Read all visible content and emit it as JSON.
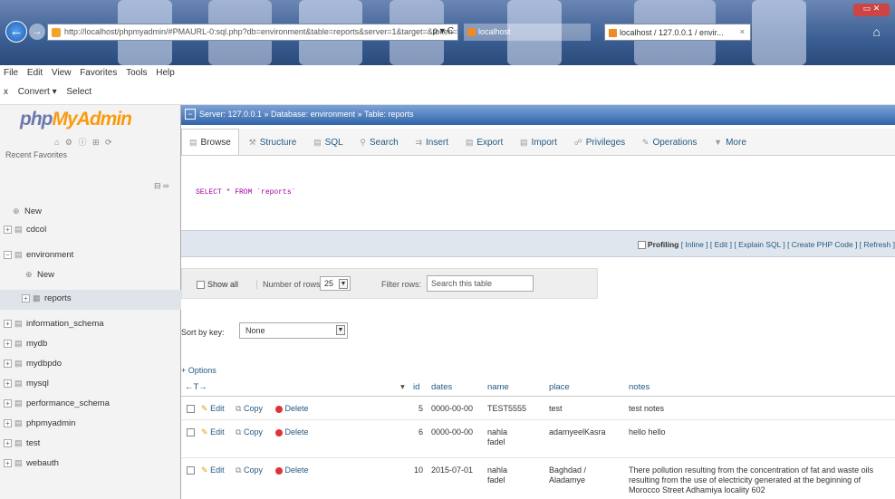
{
  "browser": {
    "address": "http://localhost/phpmyadmin/#PMAURL-0:sql.php?db=environment&table=reports&server=1&target=&token=",
    "address_controls": "ρ ▾ C",
    "tab_inactive": "localhost",
    "tab_active": "localhost / 127.0.0.1 / envir...",
    "tab_close": "×"
  },
  "menubar": [
    "File",
    "Edit",
    "View",
    "Favorites",
    "Tools",
    "Help"
  ],
  "commandbar": [
    "x",
    "Convert ▾",
    "Select"
  ],
  "sidebar": {
    "logo_php": "php",
    "logo_myadmin": "MyAdmin",
    "logo_icons": "⌂ ⚙ ⓘ ⊞ ⟳",
    "tabs": "Recent  Favorites",
    "controls": "⊟ ∞",
    "items": [
      {
        "label": "New",
        "top": 0
      },
      {
        "label": "cdcol"
      },
      {
        "label": "environment"
      },
      {
        "label": "New"
      },
      {
        "label": "reports"
      },
      {
        "label": "information_schema"
      },
      {
        "label": "mydb"
      },
      {
        "label": "mydbpdo"
      },
      {
        "label": "mysql"
      },
      {
        "label": "performance_schema"
      },
      {
        "label": "phpmyadmin"
      },
      {
        "label": "test"
      },
      {
        "label": "webauth"
      }
    ]
  },
  "breadcrumb": "Server: 127.0.0.1 » Database: environment » Table: reports",
  "topmenu": [
    "Browse",
    "Structure",
    "SQL",
    "Search",
    "Insert",
    "Export",
    "Import",
    "Privileges",
    "Operations",
    "More"
  ],
  "sql_query": "SELECT * FROM `reports`",
  "profiling": {
    "label": "Profiling",
    "links": "[ Inline ] [ Edit ] [ Explain SQL ] [ Create PHP Code ] [ Refresh ]"
  },
  "nav": {
    "show_all": "Show all",
    "number_of_rows_label": "Number of rows:",
    "number_of_rows": "25",
    "filter_label": "Filter rows:",
    "filter_placeholder": "Search this table"
  },
  "sort": {
    "label": "Sort by key:",
    "value": "None"
  },
  "options_link": "+ Options",
  "table": {
    "arrows": "←T→",
    "sort_arrow": "▾",
    "columns": [
      "id",
      "dates",
      "name",
      "place",
      "notes"
    ],
    "actions": {
      "edit": "Edit",
      "copy": "Copy",
      "delete": "Delete"
    },
    "rows": [
      {
        "id": "5",
        "dates": "0000-00-00",
        "name": "TEST5555",
        "place": "test",
        "notes": "test notes"
      },
      {
        "id": "6",
        "dates": "0000-00-00",
        "name": "nahla fadel",
        "place": "adamyeelKasra",
        "notes": "hello hello"
      },
      {
        "id": "10",
        "dates": "2015-07-01",
        "name": "nahla fadel",
        "place": "Baghdad / Aladamye",
        "notes": "There pollution resulting from the concentration of fat and waste oils resulting from the use of electricity generated at the beginning of Morocco Street Adhamiya locality 602"
      }
    ]
  }
}
